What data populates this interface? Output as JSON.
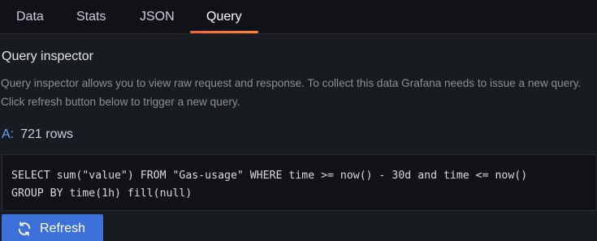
{
  "tabs": [
    {
      "label": "Data"
    },
    {
      "label": "Stats"
    },
    {
      "label": "JSON"
    },
    {
      "label": "Query",
      "active": true
    }
  ],
  "inspector": {
    "title": "Query inspector",
    "description": "Query inspector allows you to view raw request and response. To collect this data Grafana needs to issue a new query. Click refresh button below to trigger a new query."
  },
  "result": {
    "ref_id": "A:",
    "rows": "721 rows"
  },
  "query": {
    "line1": "SELECT sum(\"value\") FROM \"Gas-usage\" WHERE time >= now() - 30d and time <= now()",
    "line2": "GROUP BY time(1h) fill(null)"
  },
  "refresh_button": {
    "label": "Refresh",
    "icon": "sync-icon"
  },
  "colors": {
    "accent": "#3d71d9",
    "ref_id": "#6e9fff",
    "tab_underline": "#f55f3e"
  }
}
